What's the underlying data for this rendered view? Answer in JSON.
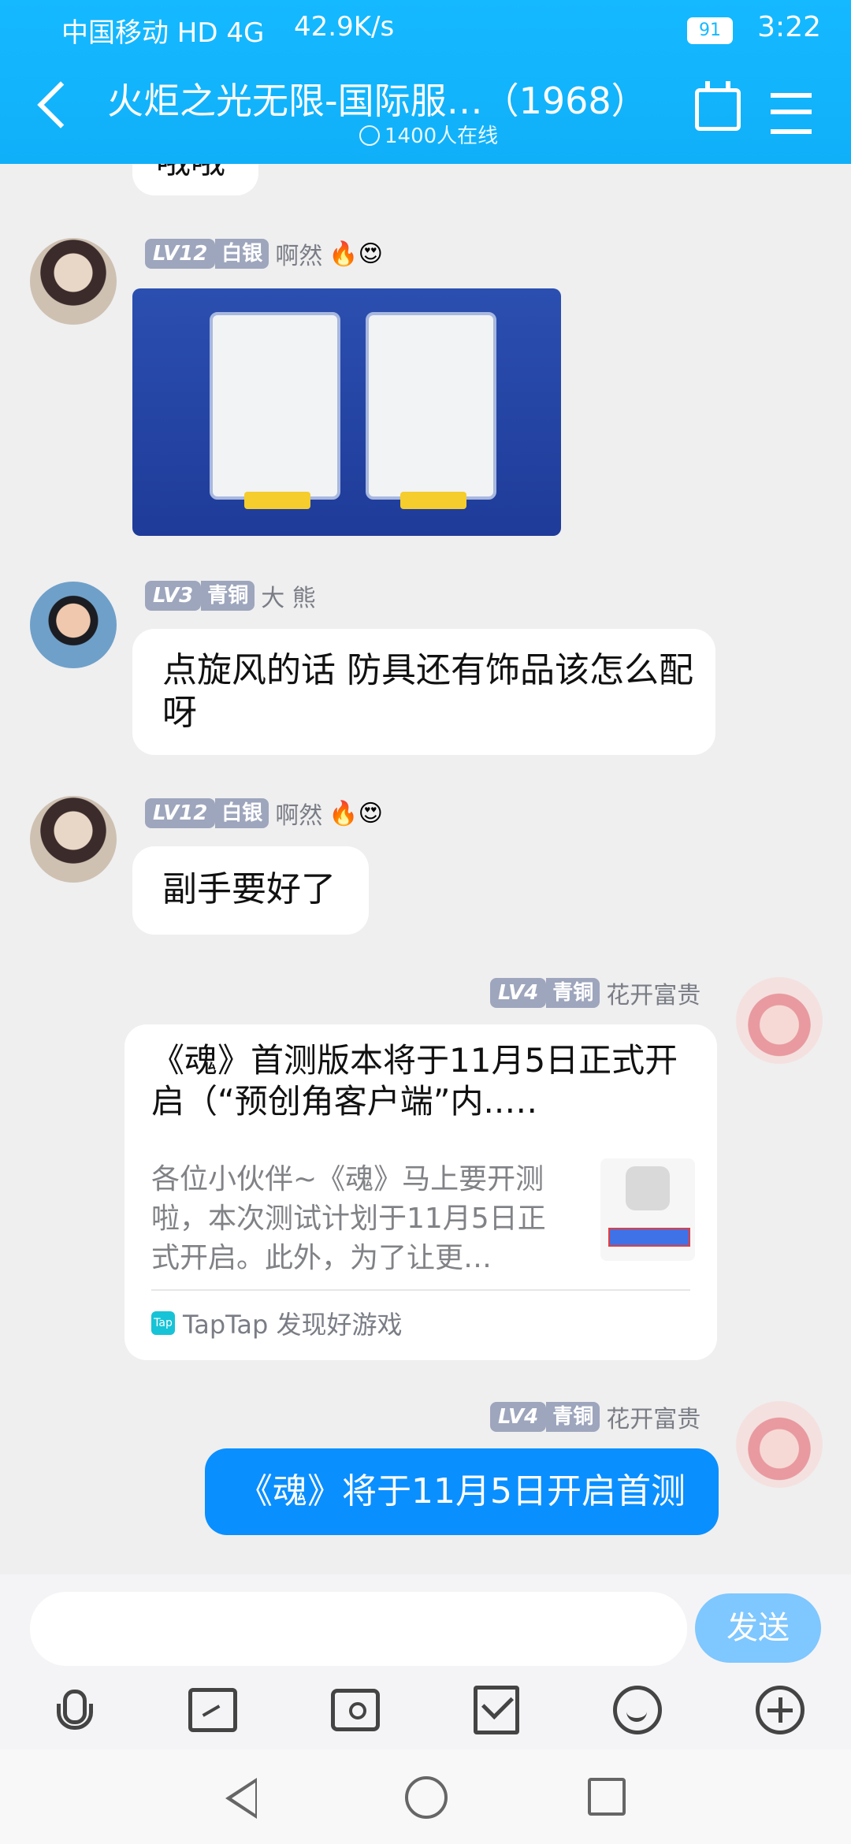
{
  "status_bar": {
    "carrier": "中国移动 HD 4G",
    "net_rate": "42.9K/s",
    "battery": "91",
    "time": "3:22"
  },
  "header": {
    "title": "火炬之光无限-国际服…（1968）",
    "online": "1400人在线"
  },
  "messages": [
    {
      "partial_text": "哦哦"
    },
    {
      "lv": "LV12",
      "rank": "白银",
      "nick": "啊然",
      "badges": "🔥😍",
      "type": "image"
    },
    {
      "lv": "LV3",
      "rank": "青铜",
      "nick": "大 熊",
      "text": "点旋风的话 防具还有饰品该怎么配呀"
    },
    {
      "lv": "LV12",
      "rank": "白银",
      "nick": "啊然",
      "badges": "🔥😍",
      "text": "副手要好了"
    },
    {
      "lv": "LV4",
      "rank": "青铜",
      "nick": "花开富贵",
      "link": {
        "title": "《魂》首测版本将于11月5日正式开启（“预创角客户端”内..…",
        "desc": "各位小伙伴~《魂》马上要开测啦，本次测试计划于11月5日正式开启。此外，为了让更…",
        "source": "TapTap 发现好游戏",
        "source_logo": "Tap"
      }
    },
    {
      "lv": "LV4",
      "rank": "青铜",
      "nick": "花开富贵",
      "text": "《魂》将于11月5日开启首测"
    }
  ],
  "input": {
    "send_label": "发送",
    "placeholder": ""
  },
  "colors": {
    "header": "#10b0f9",
    "self_bubble": "#0a8fff",
    "send_button": "#7fc7ff"
  }
}
